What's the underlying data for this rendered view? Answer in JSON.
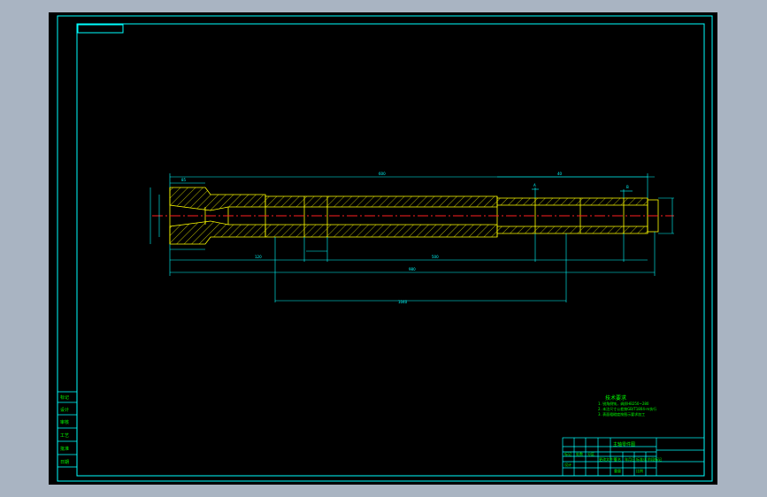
{
  "drawing": {
    "tech_req_title": "技术要求",
    "tech_req_lines": [
      "1. 锐角倒钝，调质HB250~280",
      "2. 未注尺寸公差按GB/T1804-m执行",
      "3. 表面粗糙度按图示要求加工"
    ],
    "part_name": "主轴零件图",
    "total_length_label": "1040",
    "section_label_a": "A",
    "section_label_b": "B",
    "dim_labels": [
      "85",
      "120",
      "500",
      "600",
      "40",
      "980"
    ],
    "side_labels": [
      "标记",
      "设计",
      "审核",
      "工艺",
      "批准",
      "日期"
    ],
    "title_block_cells": [
      "标记",
      "处数",
      "分区",
      "更改文件号",
      "签名",
      "年月日",
      "设计",
      "标准化",
      "阶段标记",
      "重量",
      "比例"
    ]
  },
  "colors": {
    "background": "#000000",
    "frame": "#00ffff",
    "part": "#ffff00",
    "dim": "#00ffff",
    "center": "#ff2020",
    "text": "#00ff00",
    "ui_bg": "#a9b4c2"
  }
}
